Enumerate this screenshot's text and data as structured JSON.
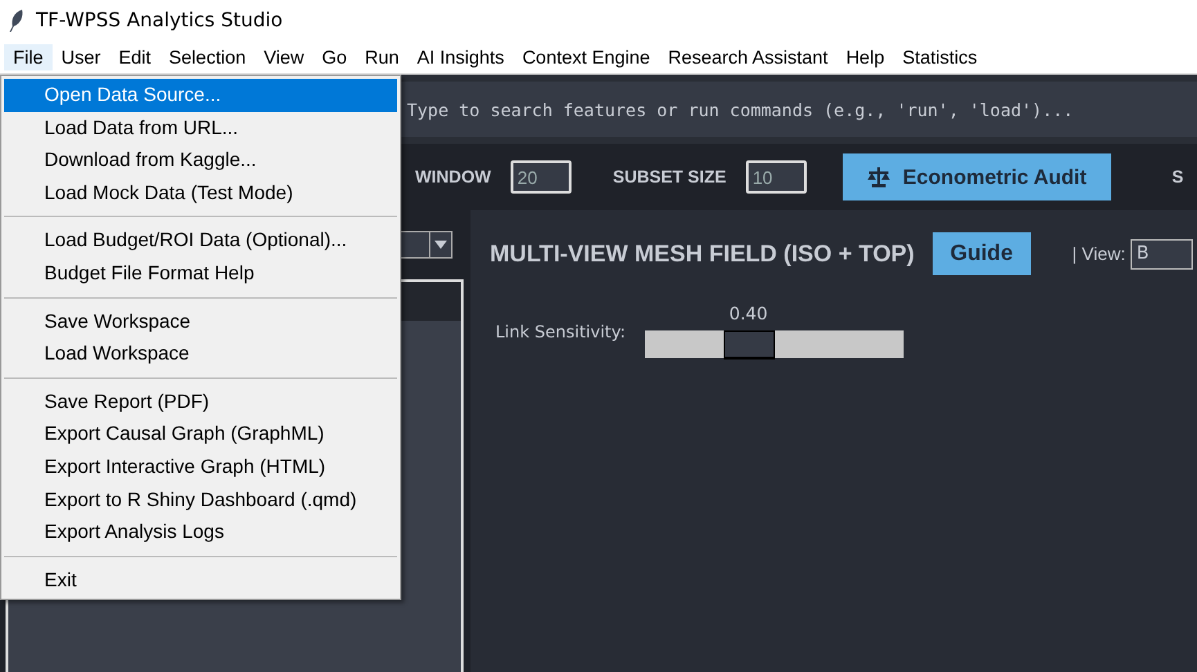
{
  "window": {
    "title": "TF-WPSS Analytics Studio"
  },
  "menubar": [
    {
      "label": "File",
      "selected": true
    },
    {
      "label": "User",
      "selected": false
    },
    {
      "label": "Edit",
      "selected": false
    },
    {
      "label": "Selection",
      "selected": false
    },
    {
      "label": "View",
      "selected": false
    },
    {
      "label": "Go",
      "selected": false
    },
    {
      "label": "Run",
      "selected": false
    },
    {
      "label": "AI Insights",
      "selected": false
    },
    {
      "label": "Context Engine",
      "selected": false
    },
    {
      "label": "Research Assistant",
      "selected": false
    },
    {
      "label": "Help",
      "selected": false
    },
    {
      "label": "Statistics",
      "selected": false
    }
  ],
  "file_menu": [
    {
      "kind": "item",
      "label": "Open Data Source...",
      "selected": true
    },
    {
      "kind": "item",
      "label": "Load Data from URL...",
      "selected": false
    },
    {
      "kind": "item",
      "label": "Download from Kaggle...",
      "selected": false
    },
    {
      "kind": "item",
      "label": "Load Mock Data (Test Mode)",
      "selected": false
    },
    {
      "kind": "separator"
    },
    {
      "kind": "item",
      "label": "Load Budget/ROI Data (Optional)...",
      "selected": false
    },
    {
      "kind": "item",
      "label": "Budget File Format Help",
      "selected": false
    },
    {
      "kind": "separator"
    },
    {
      "kind": "item",
      "label": "Save Workspace",
      "selected": false
    },
    {
      "kind": "item",
      "label": "Load Workspace",
      "selected": false
    },
    {
      "kind": "separator"
    },
    {
      "kind": "item",
      "label": "Save Report (PDF)",
      "selected": false
    },
    {
      "kind": "item",
      "label": "Export Causal Graph (GraphML)",
      "selected": false
    },
    {
      "kind": "item",
      "label": "Export Interactive Graph (HTML)",
      "selected": false
    },
    {
      "kind": "item",
      "label": "Export to R Shiny Dashboard (.qmd)",
      "selected": false
    },
    {
      "kind": "item",
      "label": "Export Analysis Logs",
      "selected": false
    },
    {
      "kind": "separator"
    },
    {
      "kind": "item",
      "label": "Exit",
      "selected": false
    }
  ],
  "search": {
    "placeholder": "Type to search features or run commands (e.g., 'run', 'load')..."
  },
  "toolbar": {
    "window_label": "WINDOW",
    "window_value": "20",
    "subset_label": "SUBSET SIZE",
    "subset_value": "10",
    "audit_button": "Econometric Audit",
    "cut_label": "S"
  },
  "main_panel": {
    "title": "MULTI-VIEW MESH FIELD (ISO + TOP)",
    "guide_button": "Guide",
    "view_label": "| View:",
    "view_value": "B",
    "slider": {
      "label": "Link Sensitivity:",
      "reading": "0.40",
      "level": 0.4
    }
  }
}
